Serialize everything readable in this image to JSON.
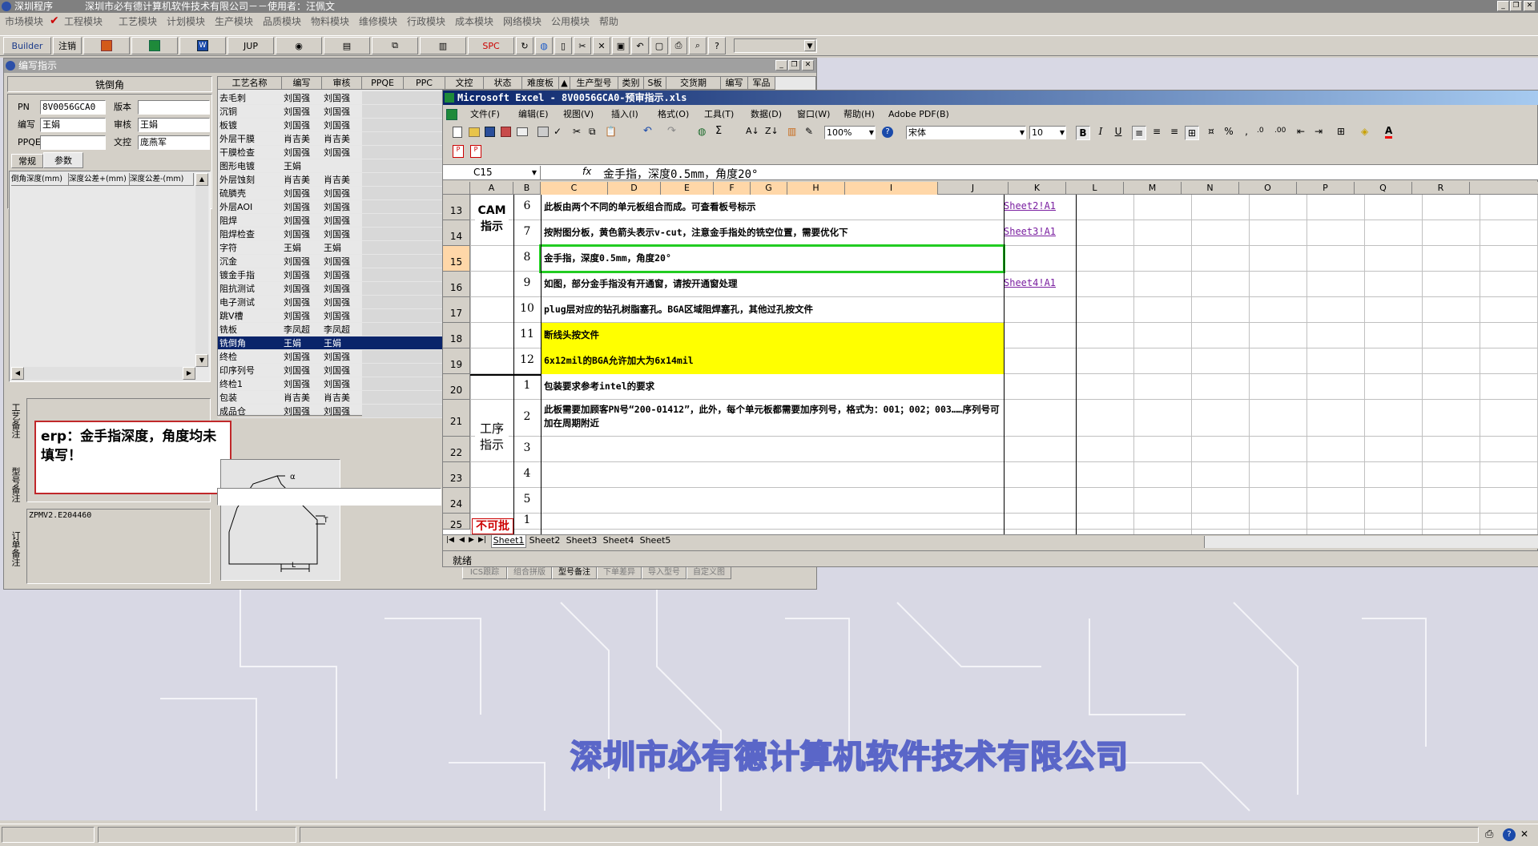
{
  "app": {
    "title_left": "深圳程序",
    "title_main": "深圳市必有德计算机软件技术有限公司－－使用者：汪佩文",
    "menus": [
      "市场模块",
      "工程模块",
      "工艺模块",
      "计划模块",
      "生产模块",
      "品质模块",
      "物料模块",
      "维修模块",
      "行政模块",
      "成本模块",
      "网络模块",
      "公用模块",
      "帮助"
    ]
  },
  "toolbar": {
    "builder": "Builder",
    "logout": "注销",
    "jup": "JUP",
    "spc": "SPC"
  },
  "editor": {
    "title": "编写指示",
    "section_title": "铣倒角",
    "labels": {
      "pn": "PN",
      "version": "版本",
      "writer": "编写",
      "reviewer": "审核",
      "ppqe": "PPQE",
      "doc_control": "文控"
    },
    "values": {
      "pn": "8V0056GCA0",
      "version": "",
      "writer": "王娟",
      "reviewer": "王娟",
      "ppqe": "",
      "doc_control": "庞燕军"
    },
    "tabs": [
      "常规",
      "参数"
    ],
    "param_headers": [
      "倒角深度(mm)",
      "深度公差+(mm)",
      "深度公差-(mm)"
    ],
    "side_labels": [
      "工艺备注",
      "型号备注",
      "订单备注"
    ],
    "erp_note": "erp：金手指深度，角度均未填写！",
    "order_note": "ZPMV2.E204460",
    "bottom_tabs": [
      "ICS跟踪",
      "组合拼版",
      "型号备注",
      "下单差异",
      "导入型号",
      "自定义图"
    ]
  },
  "process": {
    "headers": [
      "工艺名称",
      "编写",
      "审核",
      "PPQE",
      "PPC",
      "文控",
      "状态",
      "难度板",
      "生产型号",
      "类别",
      "S板",
      "交货期",
      "编写",
      "军品"
    ],
    "rows": [
      [
        "去毛刺",
        "刘国强",
        "刘国强"
      ],
      [
        "沉铜",
        "刘国强",
        "刘国强"
      ],
      [
        "板镀",
        "刘国强",
        "刘国强"
      ],
      [
        "外层干膜",
        "肖吉美",
        "肖吉美"
      ],
      [
        "干膜检查",
        "刘国强",
        "刘国强"
      ],
      [
        "图形电镀",
        "王娟",
        ""
      ],
      [
        "外层蚀刻",
        "肖吉美",
        "肖吉美"
      ],
      [
        "硫膦壳",
        "刘国强",
        "刘国强"
      ],
      [
        "外层AOI",
        "刘国强",
        "刘国强"
      ],
      [
        "阻焊",
        "刘国强",
        "刘国强"
      ],
      [
        "阻焊检查",
        "刘国强",
        "刘国强"
      ],
      [
        "字符",
        "王娟",
        "王娟"
      ],
      [
        "沉金",
        "刘国强",
        "刘国强"
      ],
      [
        "镀金手指",
        "刘国强",
        "刘国强"
      ],
      [
        "阻抗测试",
        "刘国强",
        "刘国强"
      ],
      [
        "电子测试",
        "刘国强",
        "刘国强"
      ],
      [
        "跳V槽",
        "刘国强",
        "刘国强"
      ],
      [
        "铣板",
        "李凤超",
        "李凤超"
      ],
      [
        "铣倒角",
        "王娟",
        "王娟"
      ],
      [
        "终检",
        "刘国强",
        "刘国强"
      ],
      [
        "印序列号",
        "刘国强",
        "刘国强"
      ],
      [
        "终检1",
        "刘国强",
        "刘国强"
      ],
      [
        "包装",
        "肖吉美",
        "肖吉美"
      ],
      [
        "成品仓",
        "刘国强",
        "刘国强"
      ]
    ],
    "selected_index": 18
  },
  "excel": {
    "title": "Microsoft Excel - 8V0056GCA0-预审指示.xls",
    "menus": [
      "文件(F)",
      "编辑(E)",
      "视图(V)",
      "插入(I)",
      "格式(O)",
      "工具(T)",
      "数据(D)",
      "窗口(W)",
      "帮助(H)",
      "Adobe PDF(B)"
    ],
    "zoom": "100%",
    "font_name": "宋体",
    "font_size": "10",
    "name_box": "C15",
    "formula": "金手指，深度0.5mm，角度20°",
    "fx": "fx",
    "columns": [
      "A",
      "B",
      "C",
      "D",
      "E",
      "F",
      "G",
      "H",
      "I",
      "J",
      "K",
      "L",
      "M",
      "N",
      "O",
      "P",
      "Q",
      "R"
    ],
    "rows": [
      {
        "row": "13",
        "num": "6",
        "text": "此板由两个不同的单元板组合而成。可查看板号标示",
        "link": "Sheet2!A1"
      },
      {
        "row": "14",
        "num": "7",
        "text": "按附图分板，黄色箭头表示v-cut，注意金手指处的铣空位置，需要优化下",
        "link": "Sheet3!A1"
      },
      {
        "row": "15",
        "num": "8",
        "text": "金手指，深度0.5mm，角度20°",
        "link": ""
      },
      {
        "row": "16",
        "num": "9",
        "text": "如图，部分金手指没有开通窗，请按开通窗处理",
        "link": "Sheet4!A1"
      },
      {
        "row": "17",
        "num": "10",
        "text": "plug层对应的钻孔树脂塞孔。BGA区域阻焊塞孔，其他过孔按文件",
        "link": ""
      },
      {
        "row": "18",
        "num": "11",
        "text": "断线头按文件",
        "link": ""
      },
      {
        "row": "19",
        "num": "12",
        "text": "6x12mil的BGA允许加大为6x14mil",
        "link": ""
      },
      {
        "row": "20",
        "num": "1",
        "text": "包装要求参考intel的要求",
        "link": ""
      },
      {
        "row": "21",
        "num": "2",
        "text": "此板需要加顾客PN号“200-01412”，此外，每个单元板都需要加序列号，格式为：001；002；003……序列号可加在周期附近",
        "link": ""
      },
      {
        "row": "22",
        "num": "3",
        "text": "",
        "link": ""
      },
      {
        "row": "23",
        "num": "4",
        "text": "",
        "link": ""
      },
      {
        "row": "24",
        "num": "5",
        "text": "",
        "link": ""
      },
      {
        "row": "25",
        "num": "1",
        "text": "",
        "link": ""
      }
    ],
    "group_cam": "CAM指示",
    "group_process": "工序指示",
    "red_label": "不可批",
    "sheets": [
      "Sheet1",
      "Sheet2",
      "Sheet3",
      "Sheet4",
      "Sheet5"
    ],
    "status": "就绪",
    "colors": {
      "highlight": "#ffff00",
      "selection_box": "#22cc22",
      "link": "#7a1fa0"
    }
  },
  "background_banner": "深圳市必有德计算机软件技术有限公司"
}
